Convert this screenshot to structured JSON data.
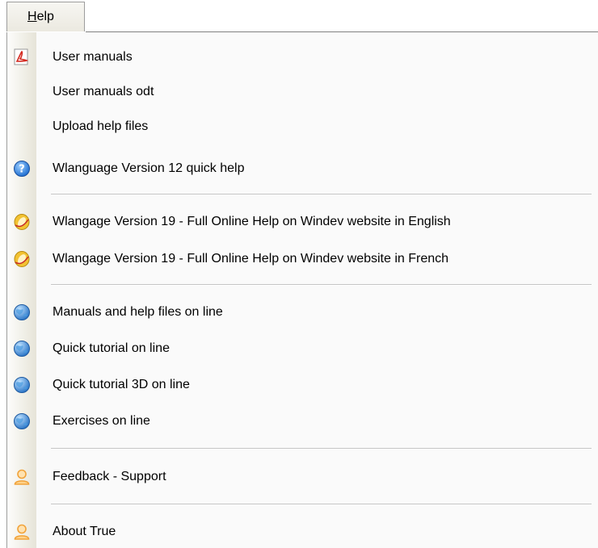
{
  "menu": {
    "title_accel": "H",
    "title_rest": "elp"
  },
  "items": [
    {
      "label": "User manuals",
      "icon": "pdf-icon"
    },
    {
      "label": "User manuals odt",
      "icon": ""
    },
    {
      "label": "Upload help files",
      "icon": ""
    },
    {
      "label": "Wlanguage Version 12 quick help",
      "icon": "help-icon"
    },
    {
      "label": "Wlangage Version 19 - Full Online Help on Windev website in English",
      "icon": "windev-icon"
    },
    {
      "label": "Wlangage Version 19 - Full Online Help on Windev website in French",
      "icon": "windev-icon"
    },
    {
      "label": "Manuals and help files on line",
      "icon": "globe-icon"
    },
    {
      "label": "Quick tutorial on line",
      "icon": "globe-icon"
    },
    {
      "label": "Quick tutorial 3D on line",
      "icon": "globe-icon"
    },
    {
      "label": "Exercises on line",
      "icon": "globe-icon"
    },
    {
      "label": "Feedback - Support",
      "icon": "user-icon"
    },
    {
      "label": "About True",
      "icon": "user-icon"
    }
  ],
  "colors": {
    "accent_blue": "#2f78c8",
    "pdf_red": "#d42a20",
    "help_blue": "#1f6fd1",
    "windev_yellow": "#f2c232",
    "user_orange": "#f1a33b"
  }
}
